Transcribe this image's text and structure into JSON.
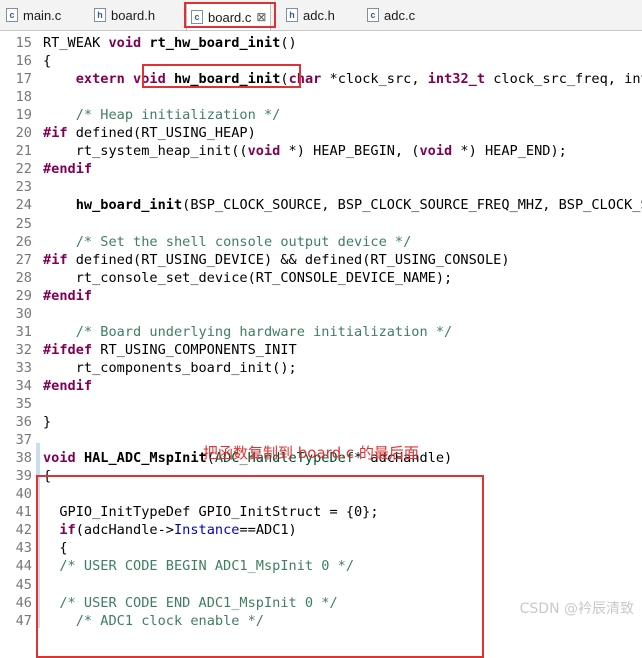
{
  "tabs": [
    {
      "label": "main.c",
      "icon": "c"
    },
    {
      "label": "board.h",
      "icon": "h"
    },
    {
      "label": "board.c",
      "icon": "c",
      "active": true,
      "close": "⊠"
    },
    {
      "label": "adc.h",
      "icon": "h"
    },
    {
      "label": "adc.c",
      "icon": "c"
    }
  ],
  "annotation": "把函数复制到 board.c 的最后面",
  "watermark": "CSDN @衿辰清致",
  "colors": {
    "highlight": "#e03232",
    "keyword": "#7f0055",
    "comment": "#3f7f5f"
  },
  "lines": [
    {
      "n": "15",
      "t": "RT_WEAK void rt_hw_board_init()"
    },
    {
      "n": "16",
      "t": "{"
    },
    {
      "n": "17",
      "t": "    extern void hw_board_init(char *clock_src, int32_t clock_src_freq, int3"
    },
    {
      "n": "18",
      "t": ""
    },
    {
      "n": "19",
      "t": "    /* Heap initialization */"
    },
    {
      "n": "20",
      "t": "#if defined(RT_USING_HEAP)"
    },
    {
      "n": "21",
      "t": "    rt_system_heap_init((void *) HEAP_BEGIN, (void *) HEAP_END);"
    },
    {
      "n": "22",
      "t": "#endif"
    },
    {
      "n": "23",
      "t": ""
    },
    {
      "n": "24",
      "t": "    hw_board_init(BSP_CLOCK_SOURCE, BSP_CLOCK_SOURCE_FREQ_MHZ, BSP_CLOCK_SY"
    },
    {
      "n": "25",
      "t": ""
    },
    {
      "n": "26",
      "t": "    /* Set the shell console output device */"
    },
    {
      "n": "27",
      "t": "#if defined(RT_USING_DEVICE) && defined(RT_USING_CONSOLE)"
    },
    {
      "n": "28",
      "t": "    rt_console_set_device(RT_CONSOLE_DEVICE_NAME);"
    },
    {
      "n": "29",
      "t": "#endif"
    },
    {
      "n": "30",
      "t": ""
    },
    {
      "n": "31",
      "t": "    /* Board underlying hardware initialization */"
    },
    {
      "n": "32",
      "t": "#ifdef RT_USING_COMPONENTS_INIT"
    },
    {
      "n": "33",
      "t": "    rt_components_board_init();"
    },
    {
      "n": "34",
      "t": "#endif"
    },
    {
      "n": "35",
      "t": ""
    },
    {
      "n": "36",
      "t": "}"
    },
    {
      "n": "37",
      "t": ""
    },
    {
      "n": "38",
      "t": "void HAL_ADC_MspInit(ADC_HandleTypeDef* adcHandle)"
    },
    {
      "n": "39",
      "t": "{"
    },
    {
      "n": "40",
      "t": ""
    },
    {
      "n": "41",
      "t": "  GPIO_InitTypeDef GPIO_InitStruct = {0};"
    },
    {
      "n": "42",
      "t": "  if(adcHandle->Instance==ADC1)"
    },
    {
      "n": "43",
      "t": "  {"
    },
    {
      "n": "44",
      "t": "  /* USER CODE BEGIN ADC1_MspInit 0 */"
    },
    {
      "n": "45",
      "t": ""
    },
    {
      "n": "46",
      "t": "  /* USER CODE END ADC1_MspInit 0 */"
    },
    {
      "n": "47",
      "t": "    /* ADC1 clock enable */"
    }
  ]
}
